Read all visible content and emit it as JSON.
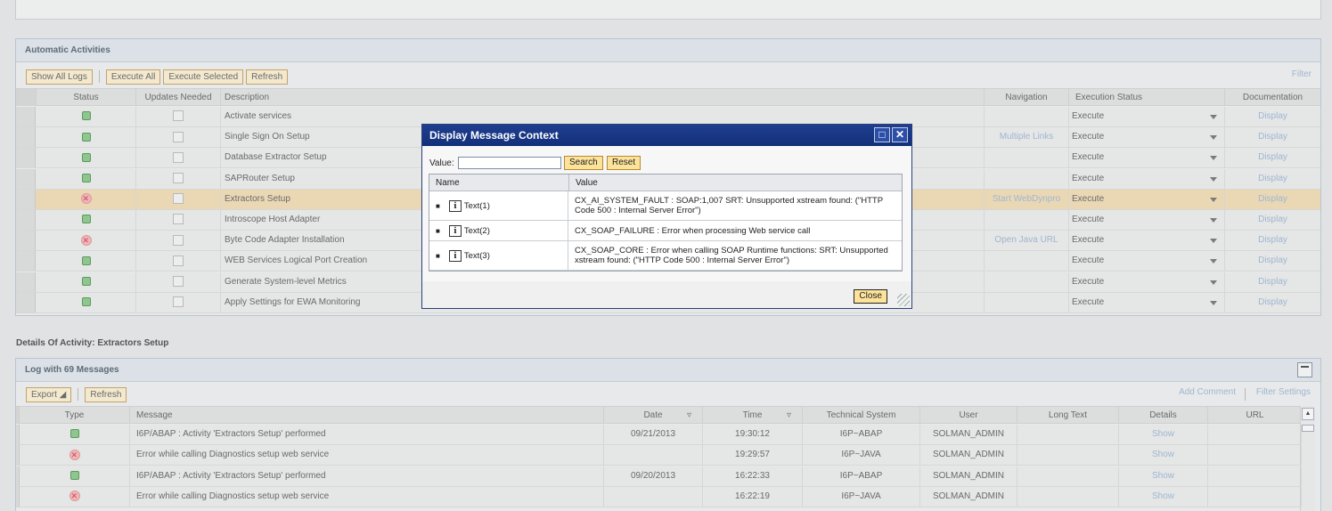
{
  "activities": {
    "title": "Automatic Activities",
    "toolbar": {
      "show_all_logs": "Show All Logs",
      "execute_all": "Execute All",
      "execute_selected": "Execute Selected",
      "refresh": "Refresh",
      "filter": "Filter"
    },
    "columns": {
      "status": "Status",
      "updates_needed": "Updates Needed",
      "description": "Description",
      "navigation": "Navigation",
      "execution_status": "Execution Status",
      "documentation": "Documentation"
    },
    "rows": [
      {
        "status": "ok",
        "description": "Activate services",
        "navigation": "",
        "exec": "Execute",
        "doc": "Display"
      },
      {
        "status": "ok",
        "description": "Single Sign On Setup",
        "navigation": "Multiple Links",
        "exec": "Execute",
        "doc": "Display"
      },
      {
        "status": "ok",
        "description": "Database Extractor Setup",
        "navigation": "",
        "exec": "Execute",
        "doc": "Display"
      },
      {
        "status": "ok",
        "description": "SAPRouter Setup",
        "navigation": "",
        "exec": "Execute",
        "doc": "Display"
      },
      {
        "status": "error",
        "description": "Extractors Setup",
        "navigation": "Start WebDynpro",
        "exec": "Execute",
        "doc": "Display",
        "selected": true
      },
      {
        "status": "ok",
        "description": "Introscope Host Adapter",
        "navigation": "",
        "exec": "Execute",
        "doc": "Display"
      },
      {
        "status": "error",
        "description": "Byte Code Adapter Installation",
        "navigation": "Open Java URL",
        "exec": "Execute",
        "doc": "Display"
      },
      {
        "status": "ok",
        "description": "WEB Services Logical Port Creation",
        "navigation": "",
        "exec": "Execute",
        "doc": "Display"
      },
      {
        "status": "ok",
        "description": "Generate System-level Metrics",
        "navigation": "",
        "exec": "Execute",
        "doc": "Display"
      },
      {
        "status": "ok",
        "description": "Apply Settings for EWA Monitoring",
        "navigation": "",
        "exec": "Execute",
        "doc": "Display"
      }
    ]
  },
  "details": {
    "title": "Details Of Activity: Extractors Setup",
    "log_title": "Log with 69 Messages",
    "toolbar": {
      "export": "Export ◢",
      "refresh": "Refresh",
      "add_comment": "Add Comment",
      "filter_settings": "Filter Settings"
    },
    "columns": {
      "type": "Type",
      "message": "Message",
      "date": "Date",
      "time": "Time",
      "technical_system": "Technical System",
      "user": "User",
      "long_text": "Long Text",
      "details": "Details",
      "url": "URL"
    },
    "rows": [
      {
        "type": "ok",
        "message": "I6P/ABAP : Activity 'Extractors Setup' performed",
        "date": "09/21/2013",
        "time": "19:30:12",
        "system": "I6P~ABAP",
        "user": "SOLMAN_ADMIN",
        "details": "Show"
      },
      {
        "type": "error",
        "message": "Error while calling Diagnostics setup web service",
        "date": "",
        "time": "19:29:57",
        "system": "I6P~JAVA",
        "user": "SOLMAN_ADMIN",
        "details": "Show"
      },
      {
        "type": "ok",
        "message": "I6P/ABAP : Activity 'Extractors Setup' performed",
        "date": "09/20/2013",
        "time": "16:22:33",
        "system": "I6P~ABAP",
        "user": "SOLMAN_ADMIN",
        "details": "Show"
      },
      {
        "type": "error",
        "message": "Error while calling Diagnostics setup web service",
        "date": "",
        "time": "16:22:19",
        "system": "I6P~JAVA",
        "user": "SOLMAN_ADMIN",
        "details": "Show"
      }
    ]
  },
  "dialog": {
    "title": "Display Message Context",
    "value_label": "Value:",
    "value_input": "",
    "search": "Search",
    "reset": "Reset",
    "col_name": "Name",
    "col_value": "Value",
    "rows": [
      {
        "name": "Text(1)",
        "value": "CX_AI_SYSTEM_FAULT : SOAP:1,007 SRT: Unsupported xstream found: (\"HTTP Code 500 : Internal Server Error\")"
      },
      {
        "name": "Text(2)",
        "value": "CX_SOAP_FAILURE : Error when processing Web service call"
      },
      {
        "name": "Text(3)",
        "value": "CX_SOAP_CORE : Error when calling SOAP Runtime functions: SRT: Unsupported xstream found: (\"HTTP Code 500 : Internal Server Error\")"
      }
    ],
    "close": "Close"
  }
}
